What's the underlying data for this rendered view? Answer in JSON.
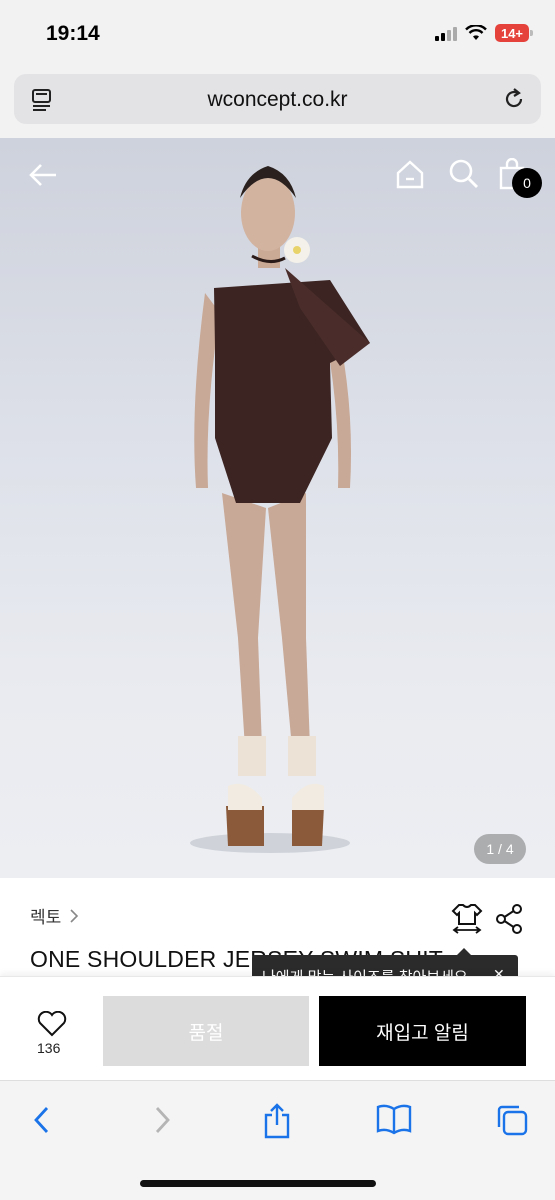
{
  "status_bar": {
    "time": "19:14",
    "battery": "14+",
    "icons": [
      "signal-icon",
      "wifi-icon",
      "battery-icon"
    ]
  },
  "browser": {
    "url": "wconcept.co.kr",
    "icons": [
      "page-menu-icon",
      "reload-icon"
    ]
  },
  "header": {
    "icons": [
      "back-arrow-icon",
      "home-icon",
      "search-icon",
      "shopping-bag-icon"
    ],
    "cart_count": "0"
  },
  "gallery": {
    "counter": "1 / 4"
  },
  "product": {
    "brand": "렉토",
    "title": "ONE SHOULDER JERSEY SWIM SUIT",
    "size_tooltip": "나에게 맞는 사이즈를 찾아보세요",
    "icons": [
      "size-guide-icon",
      "share-icon"
    ]
  },
  "actions": {
    "wish_count": "136",
    "sold_out_label": "품절",
    "restock_label": "재입고 알림",
    "colors": {
      "sold_out_bg": "#dcdcdc",
      "restock_bg": "#000000"
    }
  },
  "toolbar": {
    "icons": [
      "back-icon",
      "forward-icon",
      "share-icon",
      "bookmarks-icon",
      "tabs-icon"
    ],
    "accent": "#1a73e8"
  }
}
